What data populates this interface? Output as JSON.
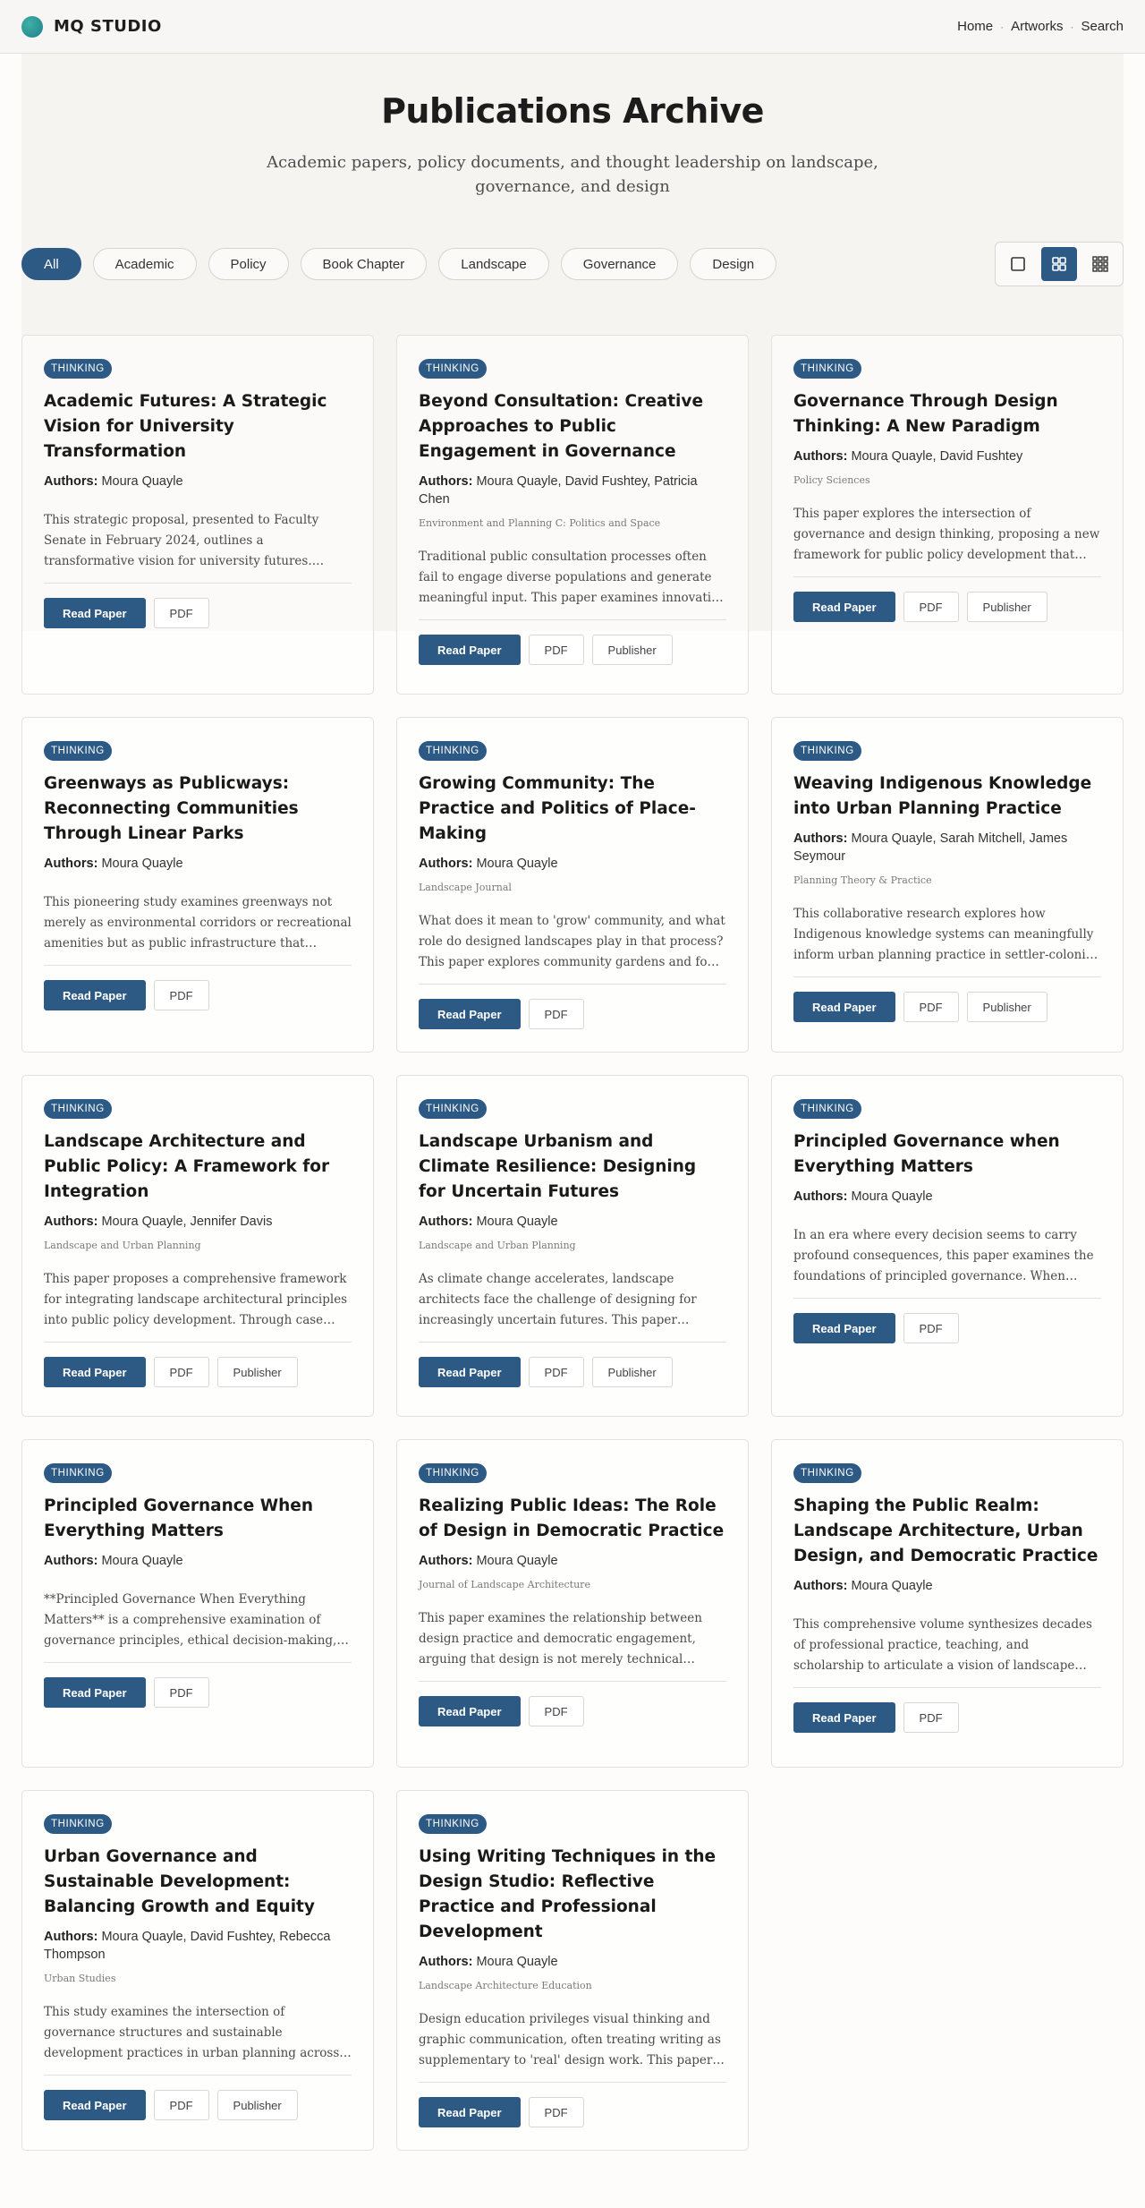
{
  "nav": {
    "brand": "MQ STUDIO",
    "links": [
      "Home",
      "Artworks",
      "Search"
    ],
    "separator": "·"
  },
  "header": {
    "title": "Publications Archive",
    "subtitle": "Academic papers, policy documents, and thought leadership on landscape, governance, and design"
  },
  "filters": [
    "All",
    "Academic",
    "Policy",
    "Book Chapter",
    "Landscape",
    "Governance",
    "Design"
  ],
  "active_filter": "All",
  "view_modes": [
    "single-icon",
    "grid-icon",
    "dense-grid-icon"
  ],
  "active_view": "grid-icon",
  "colors": {
    "accent": "#2d5a85",
    "logo": "#2a9d9a"
  },
  "labels": {
    "authors": "Authors:",
    "read": "Read Paper",
    "pdf": "PDF",
    "publisher": "Publisher"
  },
  "cards": [
    {
      "badge": "THINKING",
      "title": "Academic Futures: A Strategic Vision for University Transformation",
      "authors": "Moura Quayle",
      "journal": "",
      "excerpt": "This strategic proposal, presented to Faculty Senate in February 2024, outlines a transformative vision for university futures. Drawing on decades of experience",
      "publisher": false
    },
    {
      "badge": "THINKING",
      "title": "Beyond Consultation: Creative Approaches to Public Engagement in Governance",
      "authors": "Moura Quayle, David Fushtey, Patricia Chen",
      "journal": "Environment and Planning C: Politics and Space",
      "excerpt": "Traditional public consultation processes often fail to engage diverse populations and generate meaningful input. This paper examines innovative approaches",
      "publisher": true
    },
    {
      "badge": "THINKING",
      "title": "Governance Through Design Thinking: A New Paradigm",
      "authors": "Moura Quayle, David Fushtey",
      "journal": "Policy Sciences",
      "excerpt": "This paper explores the intersection of governance and design thinking, proposing a new framework for public policy development that emphasizes",
      "publisher": true
    },
    {
      "badge": "THINKING",
      "title": "Greenways as Publicways: Reconnecting Communities Through Linear Parks",
      "authors": "Moura Quayle",
      "journal": "",
      "excerpt": "This pioneering study examines greenways not merely as environmental corridors or recreational amenities but as public infrastructure that reconnects",
      "publisher": false
    },
    {
      "badge": "THINKING",
      "title": "Growing Community: The Practice and Politics of Place-Making",
      "authors": "Moura Quayle",
      "journal": "Landscape Journal",
      "excerpt": "What does it mean to 'grow' community, and what role do designed landscapes play in that process? This paper explores community gardens and food systems",
      "publisher": false
    },
    {
      "badge": "THINKING",
      "title": "Weaving Indigenous Knowledge into Urban Planning Practice",
      "authors": "Moura Quayle, Sarah Mitchell, James Seymour",
      "journal": "Planning Theory & Practice",
      "excerpt": "This collaborative research explores how Indigenous knowledge systems can meaningfully inform urban planning practice in settler-colonial contexts",
      "publisher": true
    },
    {
      "badge": "THINKING",
      "title": "Landscape Architecture and Public Policy: A Framework for Integration",
      "authors": "Moura Quayle, Jennifer Davis",
      "journal": "Landscape and Urban Planning",
      "excerpt": "This paper proposes a comprehensive framework for integrating landscape architectural principles into public policy development. Through case studies",
      "publisher": true
    },
    {
      "badge": "THINKING",
      "title": "Landscape Urbanism and Climate Resilience: Designing for Uncertain Futures",
      "authors": "Moura Quayle",
      "journal": "Landscape and Urban Planning",
      "excerpt": "As climate change accelerates, landscape architects face the challenge of designing for increasingly uncertain futures. This paper examines how landscape",
      "publisher": true
    },
    {
      "badge": "THINKING",
      "title": "Principled Governance when Everything Matters",
      "authors": "Moura Quayle",
      "journal": "",
      "excerpt": "In an era where every decision seems to carry profound consequences, this paper examines the foundations of principled governance. When everything",
      "publisher": false
    },
    {
      "badge": "THINKING",
      "title": "Principled Governance When Everything Matters",
      "authors": "Moura Quayle",
      "journal": "",
      "excerpt": "**Principled Governance When Everything Matters** is a comprehensive examination of governance principles, ethical decision-making, and leadership",
      "publisher": false
    },
    {
      "badge": "THINKING",
      "title": "Realizing Public Ideas: The Role of Design in Democratic Practice",
      "authors": "Moura Quayle",
      "journal": "Journal of Landscape Architecture",
      "excerpt": "This paper examines the relationship between design practice and democratic engagement, arguing that design is not merely technical expertise",
      "publisher": false
    },
    {
      "badge": "THINKING",
      "title": "Shaping the Public Realm: Landscape Architecture, Urban Design, and Democratic Practice",
      "authors": "Moura Quayle",
      "journal": "",
      "excerpt": "This comprehensive volume synthesizes decades of professional practice, teaching, and scholarship to articulate a vision of landscape architecture and",
      "publisher": false
    },
    {
      "badge": "THINKING",
      "title": "Urban Governance and Sustainable Development: Balancing Growth and Equity",
      "authors": "Moura Quayle, David Fushtey, Rebecca Thompson",
      "journal": "Urban Studies",
      "excerpt": "This study examines the intersection of governance structures and sustainable development practices in urban planning across multiple",
      "publisher": true
    },
    {
      "badge": "THINKING",
      "title": "Using Writing Techniques in the Design Studio: Reflective Practice and Professional Development",
      "authors": "Moura Quayle",
      "journal": "Landscape Architecture Education",
      "excerpt": "Design education privileges visual thinking and graphic communication, often treating writing as supplementary to 'real' design work. This paper argues",
      "publisher": false
    }
  ]
}
